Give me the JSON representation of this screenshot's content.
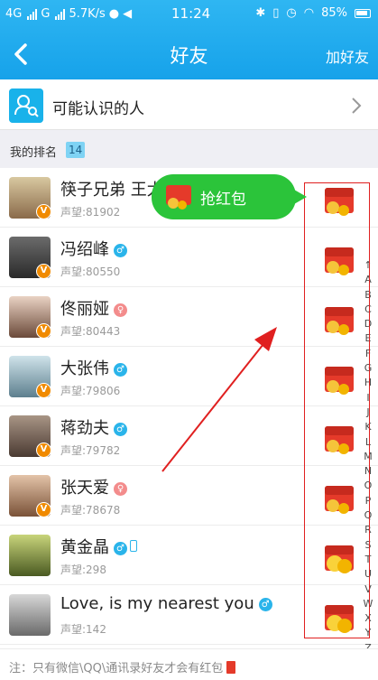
{
  "status": {
    "left": "4G",
    "carrier": "G",
    "speed": "5.7K/s",
    "time": "11:24",
    "battery": "85%"
  },
  "nav": {
    "title": "好友",
    "add_label": "加好友"
  },
  "maybe_know": {
    "label": "可能认识的人"
  },
  "rank": {
    "title": "我的排名",
    "badge": "14"
  },
  "tooltip": {
    "label": "抢红包"
  },
  "friends": [
    {
      "name": "筷子兄弟 王太",
      "reputation": "声望:81902",
      "gender": "",
      "avatar_color": "#8a6a4a"
    },
    {
      "name": "冯绍峰",
      "reputation": "声望:80550",
      "gender": "male",
      "avatar_color": "#3d3a3a"
    },
    {
      "name": "佟丽娅",
      "reputation": "声望:80443",
      "gender": "female",
      "avatar_color": "#c9a28a"
    },
    {
      "name": "大张伟",
      "reputation": "声望:79806",
      "gender": "male",
      "avatar_color": "#8fb7c9"
    },
    {
      "name": "蒋劲夫",
      "reputation": "声望:79782",
      "gender": "male",
      "avatar_color": "#6b5a4f"
    },
    {
      "name": "张天爱",
      "reputation": "声望:78678",
      "gender": "female",
      "avatar_color": "#b78a6c"
    },
    {
      "name": "黄金晶",
      "reputation": "声望:298",
      "gender": "male",
      "avatar_color": "#7c8f3a"
    },
    {
      "name": "Love, is my nearest you",
      "reputation": "声望:142",
      "gender": "male",
      "avatar_color": "#9a9a9a"
    }
  ],
  "alpha_index": [
    "↑",
    "A",
    "B",
    "C",
    "D",
    "E",
    "F",
    "G",
    "H",
    "I",
    "J",
    "K",
    "L",
    "M",
    "N",
    "O",
    "P",
    "Q",
    "R",
    "S",
    "T",
    "U",
    "V",
    "W",
    "X",
    "Y",
    "Z",
    "#"
  ],
  "footer": {
    "note": "注：只有微信\\QQ\\通讯录好友才会有红包"
  },
  "colors": {
    "header": "#1aa6ec",
    "accent_red": "#e02020",
    "tooltip_green": "#2bc43a"
  }
}
